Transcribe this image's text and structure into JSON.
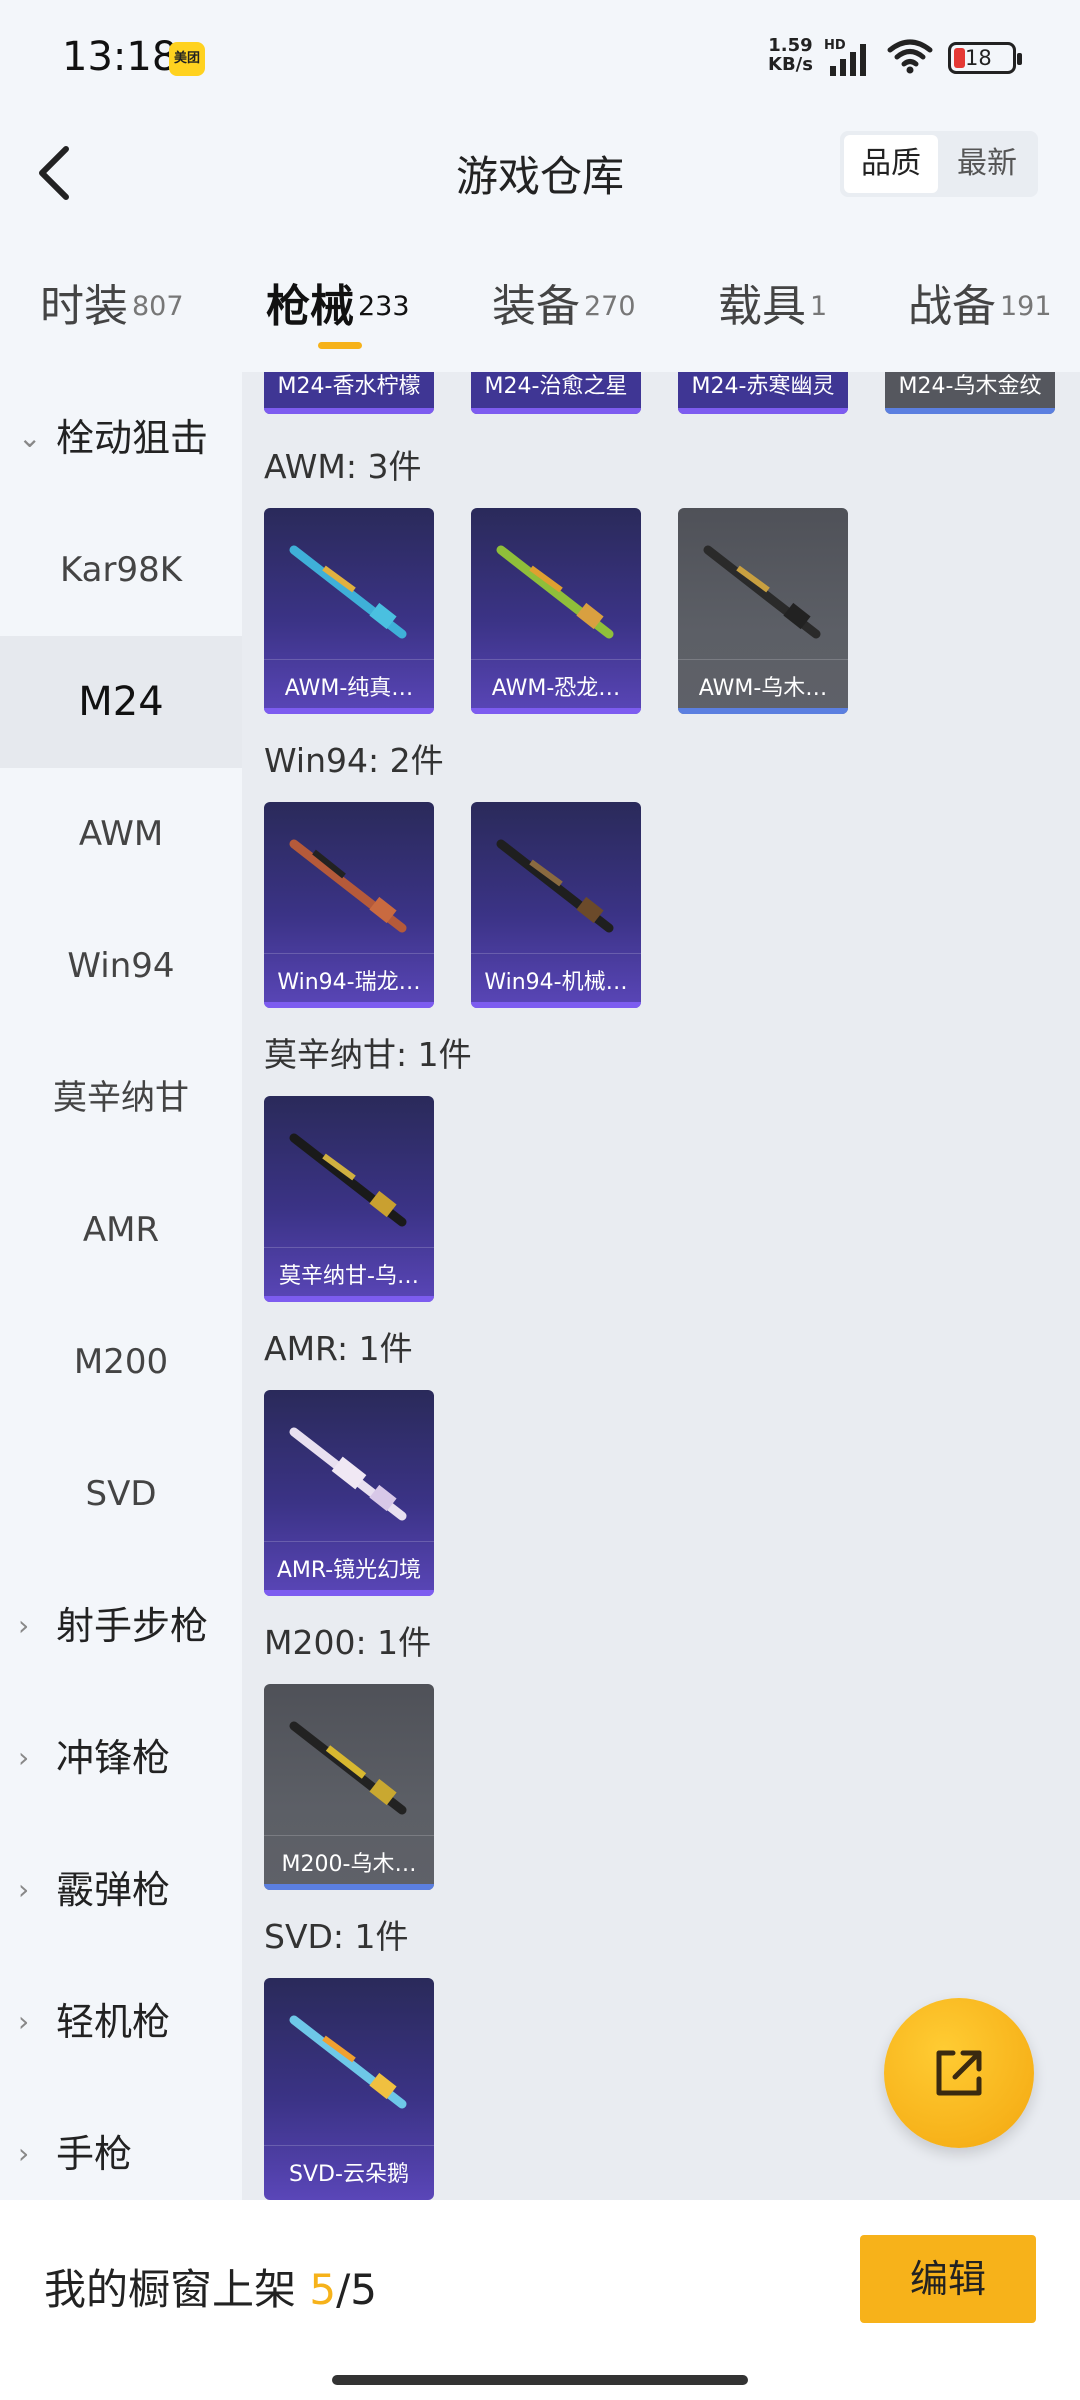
{
  "status": {
    "time": "13:18",
    "app_badge": "美团",
    "net_speed_value": "1.59",
    "net_speed_unit": "KB/s",
    "hd": "HD",
    "battery": "18"
  },
  "header": {
    "title": "游戏仓库",
    "sort_quality": "品质",
    "sort_newest": "最新"
  },
  "tabs": [
    {
      "label": "时装",
      "count": "807"
    },
    {
      "label": "枪械",
      "count": "233"
    },
    {
      "label": "装备",
      "count": "270"
    },
    {
      "label": "载具",
      "count": "1"
    },
    {
      "label": "战备",
      "count": "191"
    }
  ],
  "sidebar": {
    "group_sniper": "栓动狙击",
    "items": [
      "Kar98K",
      "M24",
      "AWM",
      "Win94",
      "莫辛纳甘",
      "AMR",
      "M200",
      "SVD"
    ],
    "groups": [
      "射手步枪",
      "冲锋枪",
      "霰弹枪",
      "轻机枪",
      "手枪"
    ]
  },
  "content": {
    "top_partial": [
      "M24-香水柠檬",
      "M24-治愈之星",
      "M24-赤寒幽灵",
      "M24-乌木金纹"
    ],
    "sections": [
      {
        "title": "AWM: 3件",
        "items": [
          "AWM-纯真…",
          "AWM-恐龙…",
          "AWM-乌木…"
        ]
      },
      {
        "title": "Win94: 2件",
        "items": [
          "Win94-瑞龙…",
          "Win94-机械…"
        ]
      },
      {
        "title": "莫辛纳甘: 1件",
        "items": [
          "莫辛纳甘-乌…"
        ]
      },
      {
        "title": "AMR: 1件",
        "items": [
          "AMR-镜光幻境"
        ]
      },
      {
        "title": "M200: 1件",
        "items": [
          "M200-乌木…"
        ]
      },
      {
        "title": "SVD: 1件",
        "items": [
          "SVD-云朵鹅"
        ]
      }
    ]
  },
  "bottom": {
    "showcase_label": "我的橱窗上架",
    "showcase_current": "5",
    "showcase_sep_total": "/5",
    "edit_label": "编辑"
  },
  "colors": {
    "accent": "#f7b21a",
    "card_purple": "#3b3386",
    "card_gray": "#5c5f66"
  }
}
